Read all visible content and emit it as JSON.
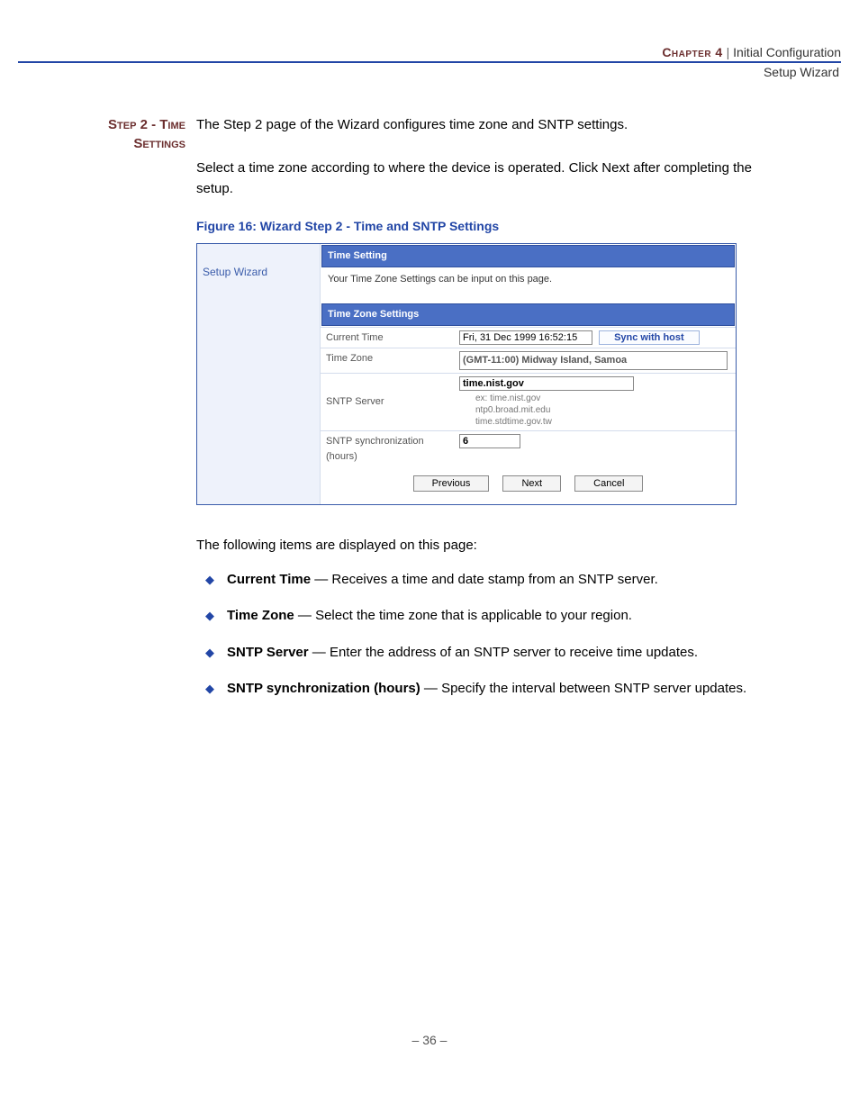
{
  "header": {
    "chapter": "Chapter 4",
    "divider": "|",
    "title": "Initial Configuration",
    "subtitle": "Setup Wizard"
  },
  "section_heading": "Step 2 - Time Settings",
  "intro_para": "The Step 2 page of the Wizard configures time zone and SNTP settings.",
  "second_para": "Select a time zone according to where the device is operated. Click Next after completing the setup.",
  "figure_caption": "Figure 16:  Wizard Step 2 - Time and SNTP Settings",
  "screenshot": {
    "left_label": "Setup Wizard",
    "bar1": "Time Setting",
    "subtext": "Your Time Zone Settings can be input on this page.",
    "bar2": "Time Zone Settings",
    "rows": {
      "current_time_label": "Current Time",
      "current_time_value": "Fri, 31 Dec 1999 16:52:15",
      "sync_btn": "Sync with host",
      "time_zone_label": "Time Zone",
      "time_zone_value": "(GMT-11:00) Midway Island, Samoa",
      "sntp_label": "SNTP Server",
      "sntp_value": "time.nist.gov",
      "ex_prefix": "ex: ",
      "ex1": "time.nist.gov",
      "ex2": "ntp0.broad.mit.edu",
      "ex3": "time.stdtime.gov.tw",
      "sync_hours_label": "SNTP synchronization (hours)",
      "sync_hours_value": "6"
    },
    "buttons": {
      "prev": "Previous",
      "next": "Next",
      "cancel": "Cancel"
    }
  },
  "following_items_text": "The following items are displayed on this page:",
  "bullets": {
    "b1_label": "Current Time",
    "b1_text": " — Receives a time and date stamp from an SNTP server.",
    "b2_label": "Time Zone",
    "b2_text": " —  Select the time zone that is applicable to your region.",
    "b3_label": "SNTP Server",
    "b3_text": " — Enter the address of an SNTP server to receive time updates.",
    "b4_label": "SNTP synchronization (hours)",
    "b4_text": " — Specify the interval between SNTP server updates."
  },
  "footer": "–  36  –"
}
